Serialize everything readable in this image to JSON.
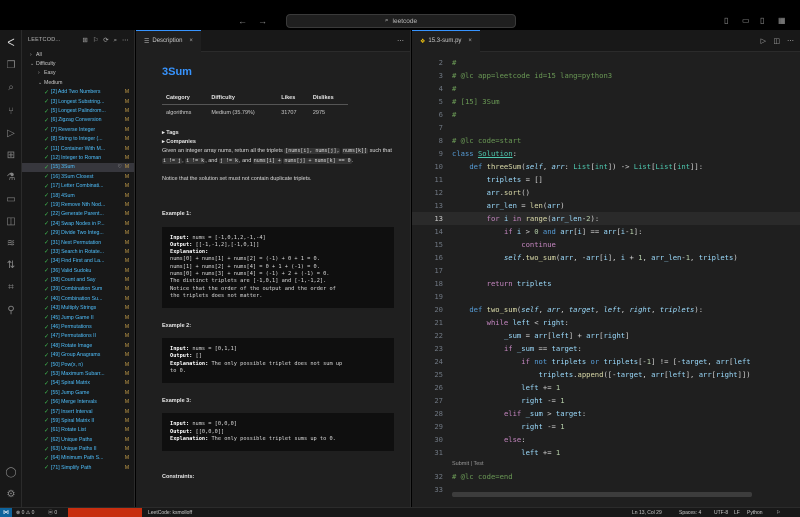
{
  "titlebar": {
    "search": "leetcode",
    "back": "←",
    "forward": "→"
  },
  "sidebar": {
    "title": "LEETCOD...",
    "tree": [
      {
        "label": "All",
        "level": 0,
        "chev": "›"
      },
      {
        "label": "Difficulty",
        "level": 0,
        "chev": "⌄"
      },
      {
        "label": "Easy",
        "level": 1,
        "chev": "›"
      },
      {
        "label": "Medium",
        "level": 1,
        "chev": "⌄"
      }
    ],
    "problems": [
      "[2] Add Two Numbers",
      "[3] Longest Substring...",
      "[5] Longest Palindrom...",
      "[6] Zigzag Conversion",
      "[7] Reverse Integer",
      "[8] String to Integer (...",
      "[11] Container With M...",
      "[12] Integer to Roman",
      "[15] 3Sum",
      "[16] 3Sum Closest",
      "[17] Letter Combinati...",
      "[18] 4Sum",
      "[19] Remove Nth Nod...",
      "[22] Generate Parent...",
      "[24] Swap Nodes in P...",
      "[29] Divide Two Integ...",
      "[31] Next Permutation",
      "[33] Search in Rotate...",
      "[34] Find First and La...",
      "[36] Valid Sudoku",
      "[38] Count and Say",
      "[39] Combination Sum",
      "[40] Combination Su...",
      "[43] Multiply Strings",
      "[45] Jump Game II",
      "[46] Permutations",
      "[47] Permutations II",
      "[48] Rotate Image",
      "[49] Group Anagrams",
      "[50] Pow(x, n)",
      "[53] Maximum Subarr...",
      "[54] Spiral Matrix",
      "[55] Jump Game",
      "[56] Merge Intervals",
      "[57] Insert Interval",
      "[59] Spiral Matrix II",
      "[61] Rotate List",
      "[62] Unique Paths",
      "[63] Unique Paths II",
      "[64] Minimum Path S...",
      "[71] Simplify Path"
    ],
    "mark": "M",
    "selected_index": 8
  },
  "description": {
    "tab": "Description",
    "title": "3Sum",
    "table": {
      "headers": [
        "Category",
        "Difficulty",
        "Likes",
        "Dislikes"
      ],
      "row": [
        "algorithms",
        "Medium (35.79%)",
        "31707",
        "2975"
      ]
    },
    "tags": "Tags",
    "companies": "Companies",
    "p1a": "Given an integer array nums, return all the triplets ",
    "p1code1": "[nums[i], nums[j],",
    "p1code2": "nums[k]]",
    "p1b": " such that ",
    "p1code3": "i != j",
    "p1c": ", ",
    "p1code4": "i != k",
    "p1d": ", and ",
    "p1code5": "j != k",
    "p1e": ", and ",
    "p1code6": "nums[i] +",
    "p1code7": "nums[j] + nums[k] == 0",
    "p1f": ".",
    "p2": "Notice that the solution set must not contain duplicate triplets.",
    "examples": [
      {
        "heading": "Example 1:",
        "input": "nums = [-1,0,1,2,-1,-4]",
        "output": "[[-1,-1,2],[-1,0,1]]",
        "explanation_label": "Explanation:",
        "explanation_lines": [
          "nums[0] + nums[1] + nums[2] = (-1) + 0 + 1 = 0.",
          "nums[1] + nums[2] + nums[4] = 0 + 1 + (-1) = 0.",
          "nums[0] + nums[3] + nums[4] = (-1) + 2 + (-1) = 0.",
          "The distinct triplets are [-1,0,1] and [-1,-1,2].",
          "Notice that the order of the output and the order of",
          "the triplets does not matter."
        ]
      },
      {
        "heading": "Example 2:",
        "input": "nums = [0,1,1]",
        "output": "[]",
        "explanation": "The only possible triplet does not sum up",
        "explanation2": "to 0."
      },
      {
        "heading": "Example 3:",
        "input": "nums = [0,0,0]",
        "output": "[[0,0,0]]",
        "explanation": "The only possible triplet sums up to 0."
      }
    ],
    "constraints": "Constraints:",
    "labels": {
      "input": "Input:",
      "output": "Output:",
      "explanation": "Explanation:"
    }
  },
  "editor": {
    "tab": "15.3-sum.py",
    "codelens": "Submit | Test",
    "current_line": 13
  },
  "status": {
    "errors": "0",
    "warnings": "0",
    "ports": "0",
    "leetcode": "LeetCode: ksmolloff",
    "position": "Ln 13, Col 29",
    "spaces": "Spaces: 4",
    "encoding": "UTF-8",
    "eol": "LF",
    "language": "Python"
  }
}
